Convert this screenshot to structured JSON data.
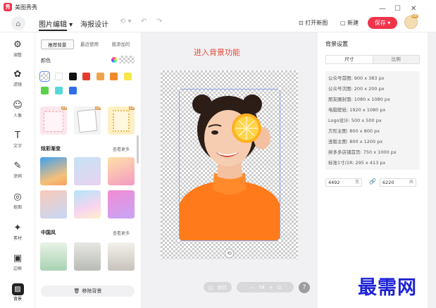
{
  "app": {
    "title": "美图秀秀",
    "logo_char": "秀"
  },
  "menu": {
    "home_icon": "home-icon",
    "items": [
      {
        "label": "图片编辑 ▾"
      },
      {
        "label": "海报设计"
      }
    ],
    "history_dropdown": "⟲ ▾",
    "undo": "↶",
    "redo": "↷",
    "open_image": "打开新图",
    "new": "新建",
    "save": "保存 ▾",
    "vip_badge": "VIP"
  },
  "window_controls": {
    "minimize": "—",
    "maximize": "☐",
    "close": "✕"
  },
  "rail": [
    {
      "icon": "adjust-icon",
      "glyph": "⚙",
      "label": "调整"
    },
    {
      "icon": "filter-icon",
      "glyph": "✿",
      "label": "滤镜"
    },
    {
      "icon": "portrait-icon",
      "glyph": "☺",
      "label": "人像"
    },
    {
      "icon": "text-icon",
      "glyph": "T",
      "label": "文字"
    },
    {
      "icon": "doodle-icon",
      "glyph": "✎",
      "label": "涂鸦"
    },
    {
      "icon": "cutout-icon",
      "glyph": "◎",
      "label": "抠图"
    },
    {
      "icon": "material-icon",
      "glyph": "✦",
      "label": "素材"
    },
    {
      "icon": "frame-icon",
      "glyph": "▣",
      "label": "边框"
    },
    {
      "icon": "background-icon",
      "glyph": "▨",
      "label": "背景",
      "active": true
    }
  ],
  "panel": {
    "tabs": [
      "推荐背景",
      "最近使用",
      "我添加的"
    ],
    "color_label": "颜色",
    "colors": [
      "#ffffff",
      "#111111",
      "#e53b2e",
      "#f0a44a",
      "#f08a2a",
      "#f7e64a",
      "#5bd14a",
      "#56d8d8",
      "#2f6ee8"
    ],
    "section_gradient": "炫彩渐变",
    "section_chinese": "中国风",
    "see_more": "查看更多",
    "remove_bg": "移除背景",
    "vip": "VIP"
  },
  "canvas": {
    "caption": "进入背景功能",
    "compare": "对比",
    "zoom_out": "—",
    "zoom_level": "78",
    "zoom_in": "+",
    "help": "?"
  },
  "right_panel": {
    "title": "背景设置",
    "segments": [
      "尺寸",
      "比例"
    ],
    "sizes": [
      "公众号首图: 900 x 383 px",
      "公众号次图: 200 x 200 px",
      "朋友圈封面: 1080 x 1080 px",
      "电脑壁纸: 1920 x 1080 px",
      "Logo设计: 500 x 500 px",
      "方形主图: 800 x 800 px",
      "竖版主图: 800 x 1200 px",
      "拼多多店铺首页: 750 x 1000 px",
      "标准1寸/1R: 295 x 413 px"
    ],
    "width": "4492",
    "height": "6220",
    "unit": "宽",
    "unit2": "高"
  },
  "watermark": "最需网"
}
